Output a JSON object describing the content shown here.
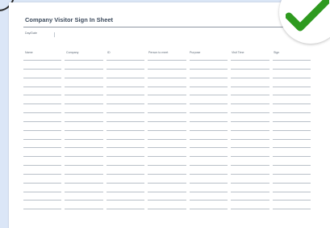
{
  "document": {
    "title": "Company Visitor Sign In Sheet",
    "day_date_label": "Day/Date",
    "columns": [
      "Name",
      "Company",
      "ID",
      "Person to meet",
      "Purpose",
      "Visit Time",
      "Sign"
    ],
    "empty_row_count": 18
  },
  "badge": {
    "icon": "checkmark-icon",
    "color": "#2e9a1f"
  }
}
